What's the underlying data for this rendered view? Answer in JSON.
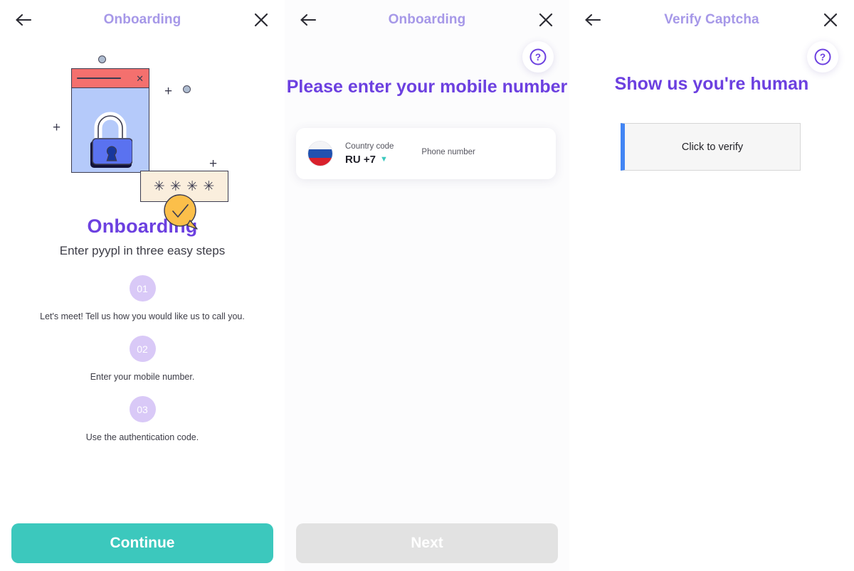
{
  "screens": [
    {
      "title": "Onboarding",
      "back_icon": "arrow-left-icon",
      "close_icon": "close-icon",
      "heading": "Onboarding",
      "subheading": "Enter pyypl in three easy steps",
      "steps": [
        {
          "number": "01",
          "text": "Let's meet! Tell us how you would like us to call you."
        },
        {
          "number": "02",
          "text": "Enter your mobile number."
        },
        {
          "number": "03",
          "text": "Use the authentication code."
        }
      ],
      "illustration": {
        "name": "security-lock-illustration",
        "window_close": "✕",
        "password_chars": "✳ ✳ ✳ ✳"
      },
      "cta_label": "Continue"
    },
    {
      "title": "Onboarding",
      "back_icon": "arrow-left-icon",
      "close_icon": "close-icon",
      "help_icon": "help-circle-icon",
      "heading": "Please enter your mobile number",
      "country_code_label": "Country code",
      "country_code_value": "RU +7",
      "country_flag": "russia-flag-icon",
      "phone_label": "Phone number",
      "phone_value": "",
      "phone_placeholder": "",
      "cta_label": "Next",
      "cta_disabled": true
    },
    {
      "title": "Verify Captcha",
      "back_icon": "arrow-left-icon",
      "close_icon": "close-icon",
      "help_icon": "help-circle-icon",
      "heading": "Show us you're human",
      "captcha_label": "Click to verify"
    }
  ],
  "colors": {
    "title_purple": "#a698e8",
    "heading_purple": "#6c40e0",
    "step_circle": "#d9c9f7",
    "primary_cta": "#3cc8bd",
    "disabled_cta": "#e2e2e2",
    "captcha_accent": "#4285f4"
  }
}
